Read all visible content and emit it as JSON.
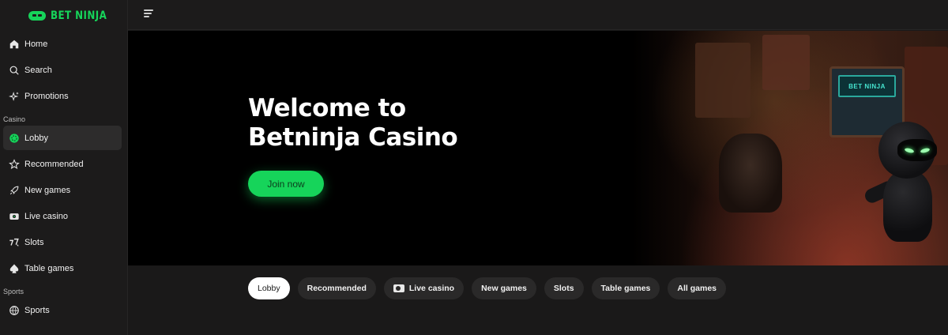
{
  "brand": {
    "name": "BET NINJA",
    "color": "#16d45a"
  },
  "sidebar": {
    "main_items": [
      {
        "label": "Home",
        "icon": "home-icon"
      },
      {
        "label": "Search",
        "icon": "search-icon"
      },
      {
        "label": "Promotions",
        "icon": "sparkles-icon"
      }
    ],
    "casino_label": "Casino",
    "casino_items": [
      {
        "label": "Lobby",
        "icon": "chip-icon",
        "active": true
      },
      {
        "label": "Recommended",
        "icon": "star-icon"
      },
      {
        "label": "New games",
        "icon": "rocket-icon"
      },
      {
        "label": "Live casino",
        "icon": "live-camera-icon"
      },
      {
        "label": "Slots",
        "icon": "sevens-icon"
      },
      {
        "label": "Table games",
        "icon": "spade-icon"
      }
    ],
    "sports_label": "Sports",
    "sports_items": [
      {
        "label": "Sports",
        "icon": "ball-icon"
      }
    ]
  },
  "hero": {
    "title_line1": "Welcome to",
    "title_line2": "Betninja Casino",
    "cta_label": "Join now",
    "arcade_text": "BET NINJA"
  },
  "categories": {
    "selected": "Lobby",
    "items": [
      "Lobby",
      "Recommended",
      "Live casino",
      "New games",
      "Slots",
      "Table games",
      "All games"
    ]
  }
}
